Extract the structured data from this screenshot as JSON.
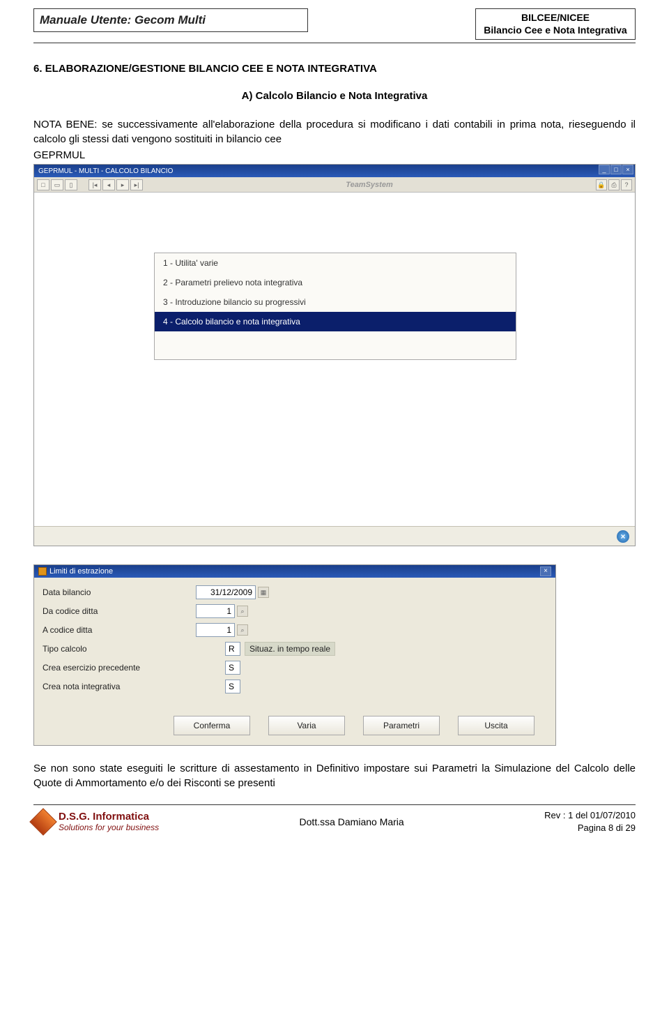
{
  "header": {
    "left": "Manuale Utente: Gecom Multi",
    "right1": "BILCEE/NICEE",
    "right2": "Bilancio Cee e Nota Integrativa"
  },
  "section": {
    "num_title": "6. ELABORAZIONE/GESTIONE  BILANCIO CEE E NOTA INTEGRATIVA",
    "sub": "A)  Calcolo Bilancio e Nota Integrativa",
    "para": "NOTA BENE: se successivamente all'elaborazione della procedura si modificano i dati contabili in prima nota, rieseguendo il calcolo gli stessi dati vengono sostituiti in bilancio cee",
    "code": "GEPRMUL"
  },
  "shot1": {
    "title": "GEPRMUL - MULTI - CALCOLO BILANCIO",
    "brand": "TeamSystem",
    "menu": [
      "1 - Utilita' varie",
      "2 - Parametri prelievo nota integrativa",
      "3 - Introduzione bilancio su progressivi",
      "4 - Calcolo bilancio e nota integrativa"
    ],
    "selected": 3
  },
  "shot2": {
    "title": "Limiti di estrazione",
    "rows": {
      "date_lbl": "Data bilancio",
      "date_val": "31/12/2009",
      "da_lbl": "Da codice ditta",
      "da_val": "1",
      "a_lbl": "A  codice ditta",
      "a_val": "1",
      "tipo_lbl": "Tipo calcolo",
      "tipo_val": "R",
      "tipo_desc": "Situaz. in tempo reale",
      "crea1_lbl": "Crea esercizio precedente",
      "crea1_val": "S",
      "crea2_lbl": "Crea nota integrativa",
      "crea2_val": "S"
    },
    "buttons": [
      "Conferma",
      "Varia",
      "Parametri",
      "Uscita"
    ]
  },
  "para2": "Se non sono state eseguiti le scritture di assestamento in Definitivo impostare sui Parametri la Simulazione del Calcolo delle Quote di Ammortamento e/o dei Risconti se presenti",
  "footer": {
    "logo1": "D.S.G. Informatica",
    "logo2": "Solutions for your business",
    "center": "Dott.ssa Damiano Maria",
    "rev": "Rev : 1 del 01/07/2010",
    "page": "Pagina 8 di 29"
  }
}
